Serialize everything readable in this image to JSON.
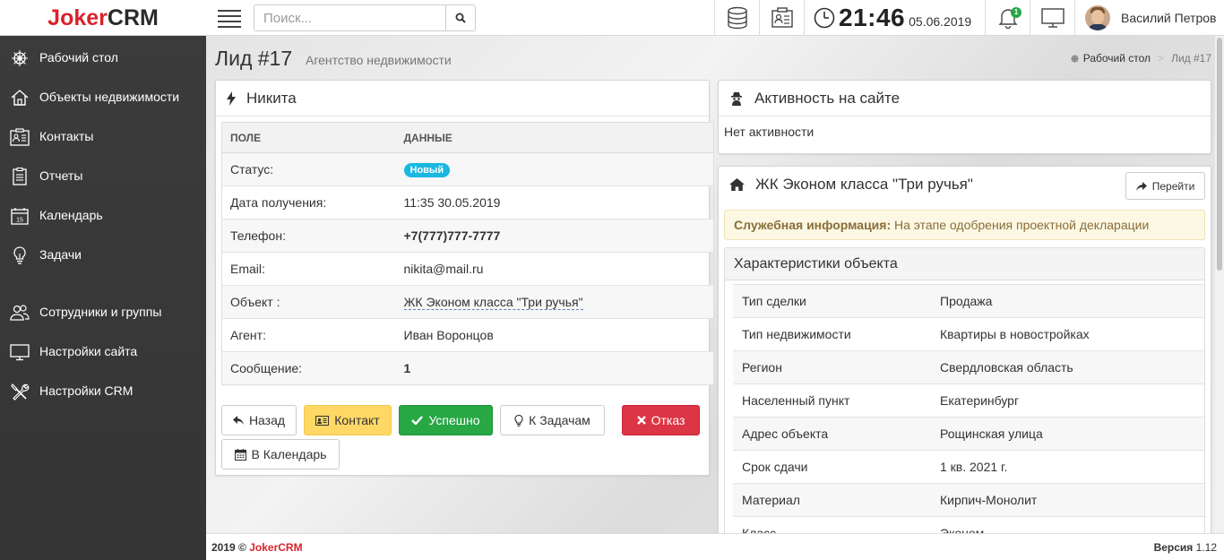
{
  "header": {
    "logo_part1": "Joker",
    "logo_part2": "CRM",
    "search_placeholder": "Поиск...",
    "clock_time": "21:46",
    "clock_date": "05.06.2019",
    "notifications_count": "1",
    "user_name": "Василий Петров"
  },
  "sidebar": {
    "items": [
      {
        "label": "Рабочий стол",
        "icon": "wheel-icon"
      },
      {
        "label": "Объекты недвижимости",
        "icon": "home-icon"
      },
      {
        "label": "Контакты",
        "icon": "contacts-icon"
      },
      {
        "label": "Отчеты",
        "icon": "reports-icon"
      },
      {
        "label": "Календарь",
        "icon": "calendar-icon"
      },
      {
        "label": "Задачи",
        "icon": "lightbulb-icon"
      },
      {
        "label": "Сотрудники и группы",
        "icon": "users-icon"
      },
      {
        "label": "Настройки сайта",
        "icon": "monitor-icon"
      },
      {
        "label": "Настройки CRM",
        "icon": "tools-icon"
      }
    ]
  },
  "page": {
    "title": "Лид #17",
    "subtitle": "Агентство недвижимости",
    "breadcrumb_home": "Рабочий стол",
    "breadcrumb_current": "Лид #17"
  },
  "lead": {
    "name": "Никита",
    "col_field": "ПОЛЕ",
    "col_data": "ДАННЫЕ",
    "rows": [
      {
        "field": "Статус:",
        "value": "Новый"
      },
      {
        "field": "Дата получения:",
        "value": "11:35 30.05.2019"
      },
      {
        "field": "Телефон:",
        "value": "+7(777)777-7777"
      },
      {
        "field": "Email:",
        "value": "nikita@mail.ru"
      },
      {
        "field": "Объект :",
        "value": "ЖК Эконом класса \"Три ручья\""
      },
      {
        "field": "Агент:",
        "value": "Иван Воронцов"
      },
      {
        "field": "Сообщение:",
        "value": "1"
      }
    ],
    "buttons": {
      "back": "Назад",
      "contact": "Контакт",
      "success": "Успешно",
      "tasks": "К Задачам",
      "reject": "Отказ",
      "calendar": "В Календарь"
    }
  },
  "activity": {
    "title": "Активность на сайте",
    "text": "Нет активности"
  },
  "property": {
    "title": "ЖК Эконом класса \"Три ручья\"",
    "goto_label": "Перейти",
    "notice_label": "Служебная информация:",
    "notice_text": "На этапе одобрения проектной декларации",
    "char_title": "Характеристики объекта",
    "rows": [
      {
        "field": "Тип сделки",
        "value": "Продажа"
      },
      {
        "field": "Тип недвижимости",
        "value": "Квартиры в новостройках"
      },
      {
        "field": "Регион",
        "value": "Свердловская область"
      },
      {
        "field": "Населенный пункт",
        "value": "Екатеринбург"
      },
      {
        "field": "Адрес объекта",
        "value": "Рощинская улица"
      },
      {
        "field": "Срок сдачи",
        "value": "1 кв. 2021 г."
      },
      {
        "field": "Материал",
        "value": "Кирпич-Монолит"
      },
      {
        "field": "Класс",
        "value": "Эконом"
      }
    ]
  },
  "footer": {
    "copyright_year": "2019 ©",
    "brand": "JokerCRM",
    "version_label": "Версия",
    "version": "1.12"
  }
}
